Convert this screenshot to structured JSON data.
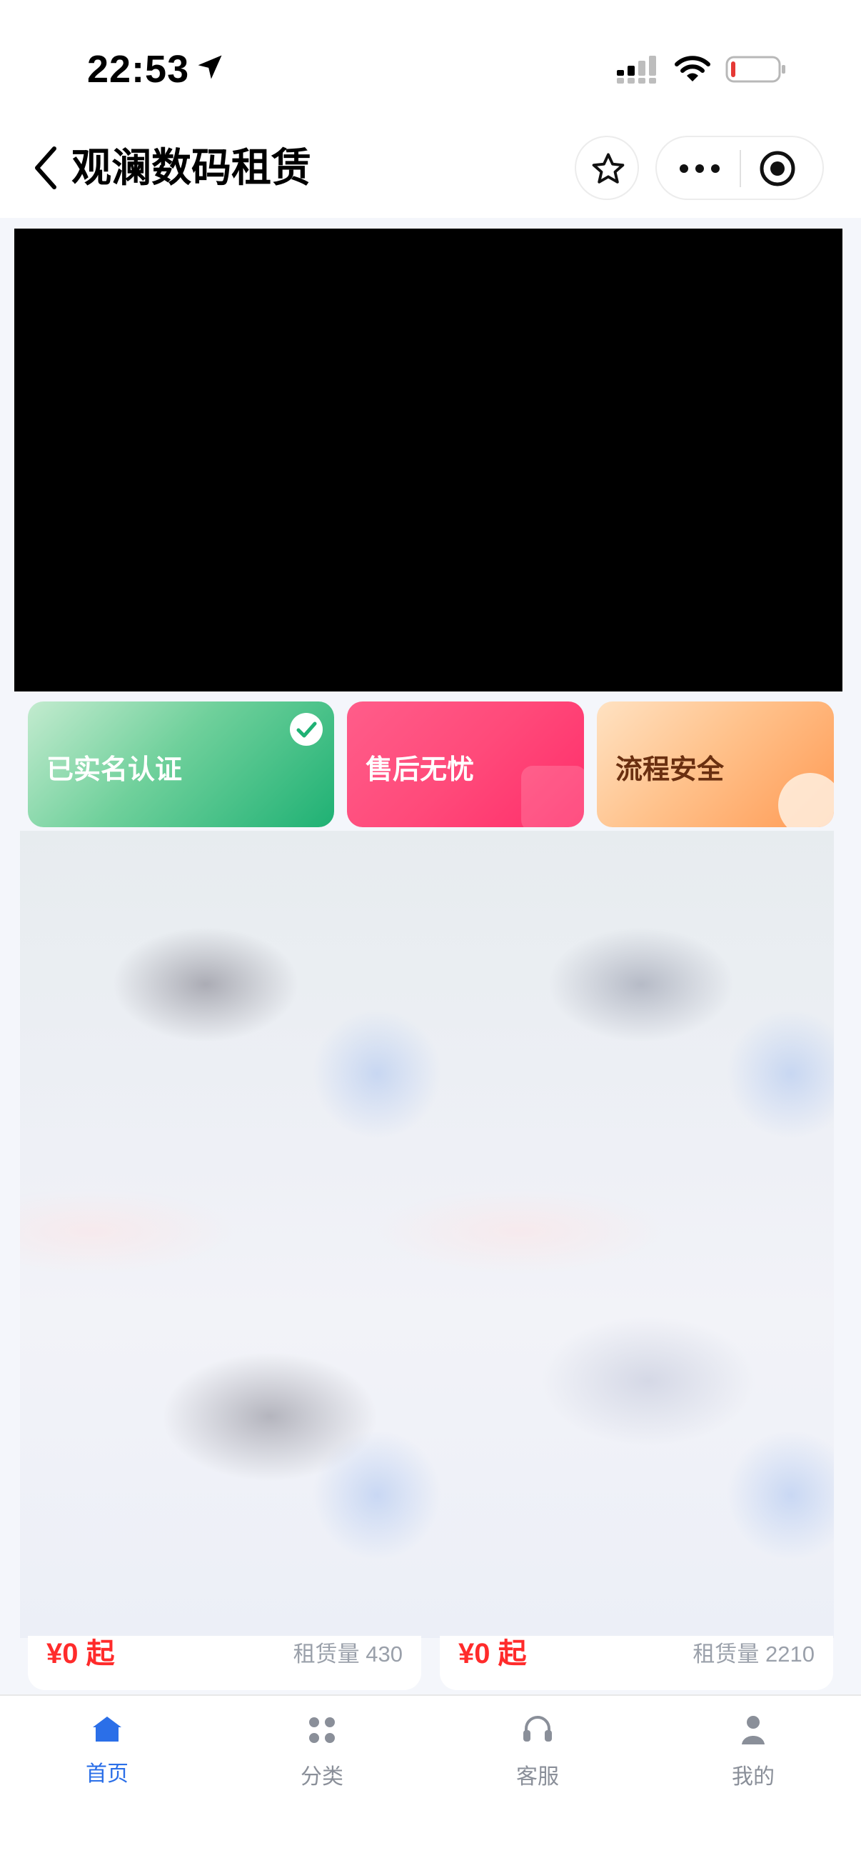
{
  "status_bar": {
    "time": "22:53",
    "icons": [
      "location-arrow-icon",
      "cellular-signal-icon",
      "wifi-icon",
      "battery-low-icon"
    ],
    "battery_color": "#e53935"
  },
  "nav": {
    "title": "观澜数码租赁",
    "icons": [
      "back-chevron-icon",
      "star-icon",
      "more-dots-icon",
      "target-icon"
    ]
  },
  "banner": {
    "background": "#000000"
  },
  "features": [
    {
      "label": "已实名认证",
      "color": "#1fb174"
    },
    {
      "label": "售后无忧",
      "color": "#ff2d6a"
    },
    {
      "label": "流程安全",
      "color": "#ff9a54"
    }
  ],
  "products": [
    {
      "price": "¥0 起",
      "rent": "租赁量 430"
    },
    {
      "price": "¥0 起",
      "rent": "租赁量 2210"
    }
  ],
  "tabs": [
    {
      "label": "首页",
      "icon": "home-icon",
      "active": true
    },
    {
      "label": "分类",
      "icon": "category-grid-icon",
      "active": false
    },
    {
      "label": "客服",
      "icon": "headset-icon",
      "active": false
    },
    {
      "label": "我的",
      "icon": "profile-icon",
      "active": false
    }
  ],
  "colors": {
    "accent": "#2b6fe8",
    "price": "#ff2b2b",
    "muted": "#9aa0aa"
  }
}
